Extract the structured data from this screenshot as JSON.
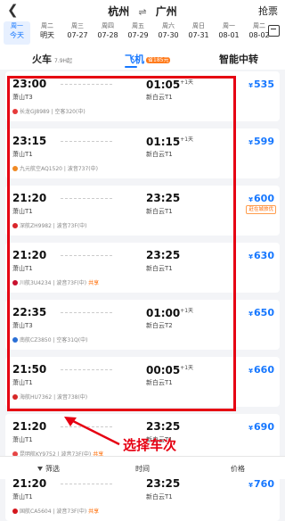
{
  "header": {
    "back_icon": "chevron-left-icon",
    "from": "杭州",
    "swap_symbol": "⇌",
    "to": "广州",
    "grab_label": "抢票"
  },
  "dates": [
    {
      "weekday": "周一",
      "date": "今天",
      "active": true
    },
    {
      "weekday": "周二",
      "date": "明天"
    },
    {
      "weekday": "周三",
      "date": "07-27"
    },
    {
      "weekday": "周四",
      "date": "07-28"
    },
    {
      "weekday": "周五",
      "date": "07-29"
    },
    {
      "weekday": "周六",
      "date": "07-30"
    },
    {
      "weekday": "周日",
      "date": "07-31"
    },
    {
      "weekday": "周一",
      "date": "08-01"
    },
    {
      "weekday": "周二",
      "date": "08-02"
    }
  ],
  "tabs": {
    "train": {
      "label": "火车",
      "sub": "7.9H起"
    },
    "flight": {
      "label": "飞机",
      "badge": "省185元"
    },
    "transfer": {
      "label": "智能中转"
    }
  },
  "flights": [
    {
      "dep_time": "23:00",
      "dep_airport": "萧山T3",
      "arr_time": "01:05",
      "day_offset": "+1天",
      "arr_airport": "新白云T1",
      "airline": "长龙GJ8989 | 空客320(中)",
      "share": "",
      "price": "535",
      "logo_color": "#e63a3a",
      "tag": ""
    },
    {
      "dep_time": "23:15",
      "dep_airport": "萧山T1",
      "arr_time": "01:15",
      "day_offset": "+1天",
      "arr_airport": "新白云T1",
      "airline": "九元航空AQ1520 | 波音737(中)",
      "share": "",
      "price": "599",
      "logo_color": "#f08a24",
      "tag": ""
    },
    {
      "dep_time": "21:20",
      "dep_airport": "萧山T1",
      "arr_time": "23:25",
      "day_offset": "",
      "arr_airport": "新白云T1",
      "airline": "深航ZH9982 | 波音73F(中)",
      "share": "",
      "price": "600",
      "logo_color": "#d9252a",
      "tag": "赶在城旅优"
    },
    {
      "dep_time": "21:20",
      "dep_airport": "萧山T1",
      "arr_time": "23:25",
      "day_offset": "",
      "arr_airport": "新白云T1",
      "airline": "川航3U4234 | 波音73F(中)",
      "share": "共享",
      "price": "630",
      "logo_color": "#c8102e",
      "tag": ""
    },
    {
      "dep_time": "22:35",
      "dep_airport": "萧山T3",
      "arr_time": "01:00",
      "day_offset": "+1天",
      "arr_airport": "新白云T2",
      "airline": "南航CZ3850 | 空客31Q(中)",
      "share": "",
      "price": "650",
      "logo_color": "#2a6fd6",
      "tag": ""
    },
    {
      "dep_time": "21:50",
      "dep_airport": "萧山T1",
      "arr_time": "00:05",
      "day_offset": "+1天",
      "arr_airport": "新白云T1",
      "airline": "海航HU7362 | 波音738(中)",
      "share": "",
      "price": "660",
      "logo_color": "#d62828",
      "tag": ""
    },
    {
      "dep_time": "21:20",
      "dep_airport": "萧山T1",
      "arr_time": "23:25",
      "day_offset": "",
      "arr_airport": "新白云T1",
      "airline": "昆明航KY9752 | 波音73F(中)",
      "share": "共享",
      "price": "690",
      "logo_color": "#e64545",
      "tag": ""
    },
    {
      "dep_time": "21:20",
      "dep_airport": "萧山T1",
      "arr_time": "23:25",
      "day_offset": "",
      "arr_airport": "新白云T1",
      "airline": "国航CA5604 | 波音73F(中)",
      "share": "共享",
      "price": "760",
      "logo_color": "#d4161c",
      "tag": ""
    }
  ],
  "annotation": {
    "label": "选择车次",
    "color": "#e60012"
  },
  "bottom_bar": {
    "filter": "筛选",
    "time": "时间",
    "price": "价格"
  },
  "colors": {
    "accent": "#1677ff",
    "highlight": "#e60012"
  }
}
